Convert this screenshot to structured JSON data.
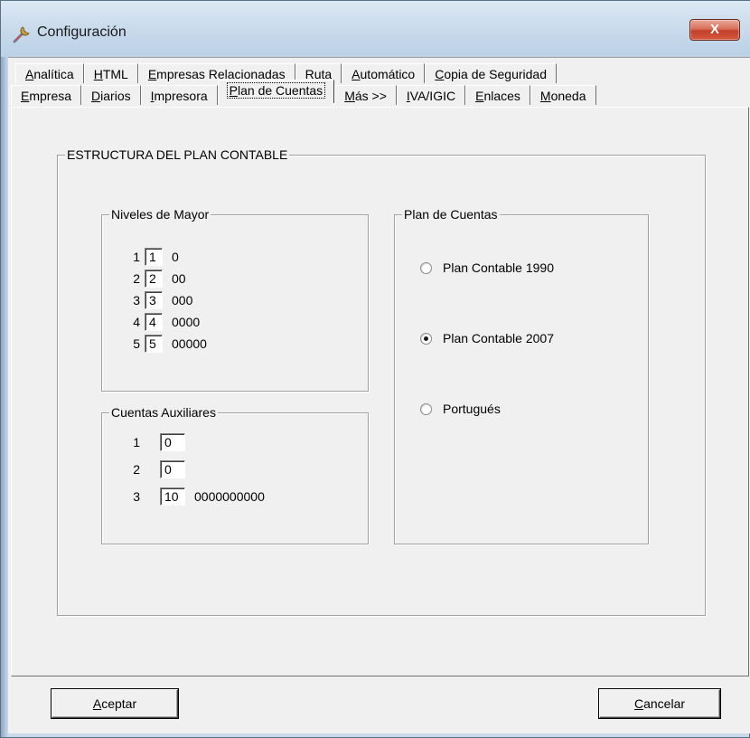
{
  "window": {
    "title": "Configuración",
    "close_label": "X"
  },
  "tabs_row1": [
    {
      "pre": "",
      "ul": "A",
      "post": "nalítica"
    },
    {
      "pre": "",
      "ul": "H",
      "post": "TML"
    },
    {
      "pre": "",
      "ul": "E",
      "post": "mpresas Relacionadas"
    },
    {
      "pre": "",
      "ul": "R",
      "post": "uta"
    },
    {
      "pre": "",
      "ul": "A",
      "post": "utomático"
    },
    {
      "pre": "",
      "ul": "C",
      "post": "opia de Seguridad"
    }
  ],
  "tabs_row2": [
    {
      "pre": "",
      "ul": "E",
      "post": "mpresa"
    },
    {
      "pre": "",
      "ul": "D",
      "post": "iarios"
    },
    {
      "pre": "",
      "ul": "I",
      "post": "mpresora"
    },
    {
      "pre": "",
      "ul": "P",
      "post": "lan de Cuentas",
      "active": true
    },
    {
      "pre": "",
      "ul": "M",
      "post": "ás >>"
    },
    {
      "pre": "",
      "ul": "I",
      "post": "VA/IGIC"
    },
    {
      "pre": "",
      "ul": "E",
      "post": "nlaces"
    },
    {
      "pre": "",
      "ul": "M",
      "post": "oneda"
    }
  ],
  "structure_group": {
    "label": "ESTRUCTURA DEL PLAN CONTABLE"
  },
  "niveles_mayor": {
    "label": "Niveles de Mayor",
    "rows": [
      {
        "num": "1",
        "value": "1",
        "mask": "0"
      },
      {
        "num": "2",
        "value": "2",
        "mask": "00"
      },
      {
        "num": "3",
        "value": "3",
        "mask": "000"
      },
      {
        "num": "4",
        "value": "4",
        "mask": "0000"
      },
      {
        "num": "5",
        "value": "5",
        "mask": "00000"
      }
    ]
  },
  "cuentas_auxiliares": {
    "label": "Cuentas Auxiliares",
    "rows": [
      {
        "num": "1",
        "value": "0",
        "mask": ""
      },
      {
        "num": "2",
        "value": "0",
        "mask": ""
      },
      {
        "num": "3",
        "value": "10",
        "mask": "0000000000"
      }
    ]
  },
  "plan_cuentas": {
    "label": "Plan de Cuentas",
    "options": [
      {
        "label": "Plan Contable 1990",
        "checked": false
      },
      {
        "label": "Plan Contable 2007",
        "checked": true
      },
      {
        "label": "Portugués",
        "checked": false
      }
    ]
  },
  "buttons": {
    "accept": {
      "ul": "A",
      "post": "ceptar"
    },
    "cancel": {
      "ul": "C",
      "post": "ancelar"
    }
  }
}
